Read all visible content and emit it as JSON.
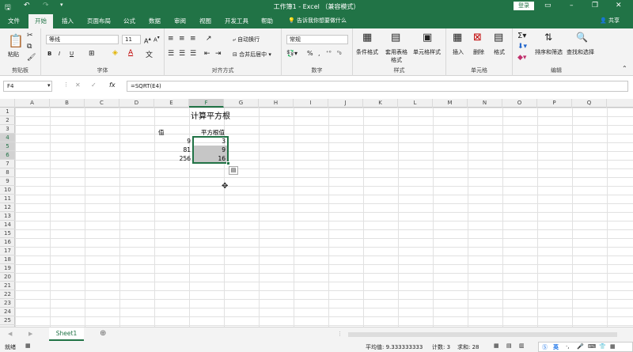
{
  "titlebar": {
    "title": "工作簿1 - Excel",
    "title_mode": "（兼容模式）",
    "login": "登录"
  },
  "tabs": [
    "文件",
    "开始",
    "插入",
    "页面布局",
    "公式",
    "数据",
    "审阅",
    "视图",
    "开发工具",
    "帮助"
  ],
  "tellme": "告诉我你想要做什么",
  "share": "共享",
  "ribbon": {
    "clipboard": {
      "paste": "粘贴",
      "label": "剪贴板"
    },
    "font": {
      "name": "等线",
      "size": "11",
      "label": "字体",
      "bold": "B",
      "italic": "I",
      "underline": "U"
    },
    "alignment": {
      "wrap": "自动换行",
      "merge": "合并后居中",
      "label": "对齐方式"
    },
    "number": {
      "format": "常规",
      "label": "数字"
    },
    "styles": {
      "cond": "条件格式",
      "table": "套用表格格式",
      "cell": "单元格样式",
      "label": "样式"
    },
    "cells": {
      "insert": "插入",
      "delete": "删除",
      "format": "格式",
      "label": "单元格"
    },
    "editing": {
      "sortfilter": "排序和筛选",
      "findselect": "查找和选择",
      "label": "编辑"
    }
  },
  "formula": {
    "namebox": "F4",
    "content": "=SQRT(E4)",
    "fx": "fx"
  },
  "columns": [
    "A",
    "B",
    "C",
    "D",
    "E",
    "F",
    "G",
    "H",
    "I",
    "J",
    "K",
    "L",
    "M",
    "N",
    "O",
    "P",
    "Q"
  ],
  "rows": [
    "1",
    "2",
    "3",
    "4",
    "5",
    "6",
    "7",
    "8",
    "9",
    "10",
    "11",
    "12",
    "13",
    "14",
    "15",
    "16",
    "17",
    "18",
    "19",
    "20",
    "21",
    "22",
    "23",
    "24",
    "25"
  ],
  "cells": {
    "title": "计算平方根",
    "e3": "值",
    "f3": "平方根值",
    "e4": "9",
    "f4": "3",
    "e5": "81",
    "f5": "9",
    "e6": "256",
    "f6": "16"
  },
  "sheet": {
    "tab": "Sheet1"
  },
  "status": {
    "ready": "就绪",
    "average": "平均值: 9.333333333",
    "count": "计数: 3",
    "sum": "求和: 28",
    "ime": "英"
  },
  "colors": {
    "brand": "#217346",
    "selection": "#c6c6c6"
  }
}
